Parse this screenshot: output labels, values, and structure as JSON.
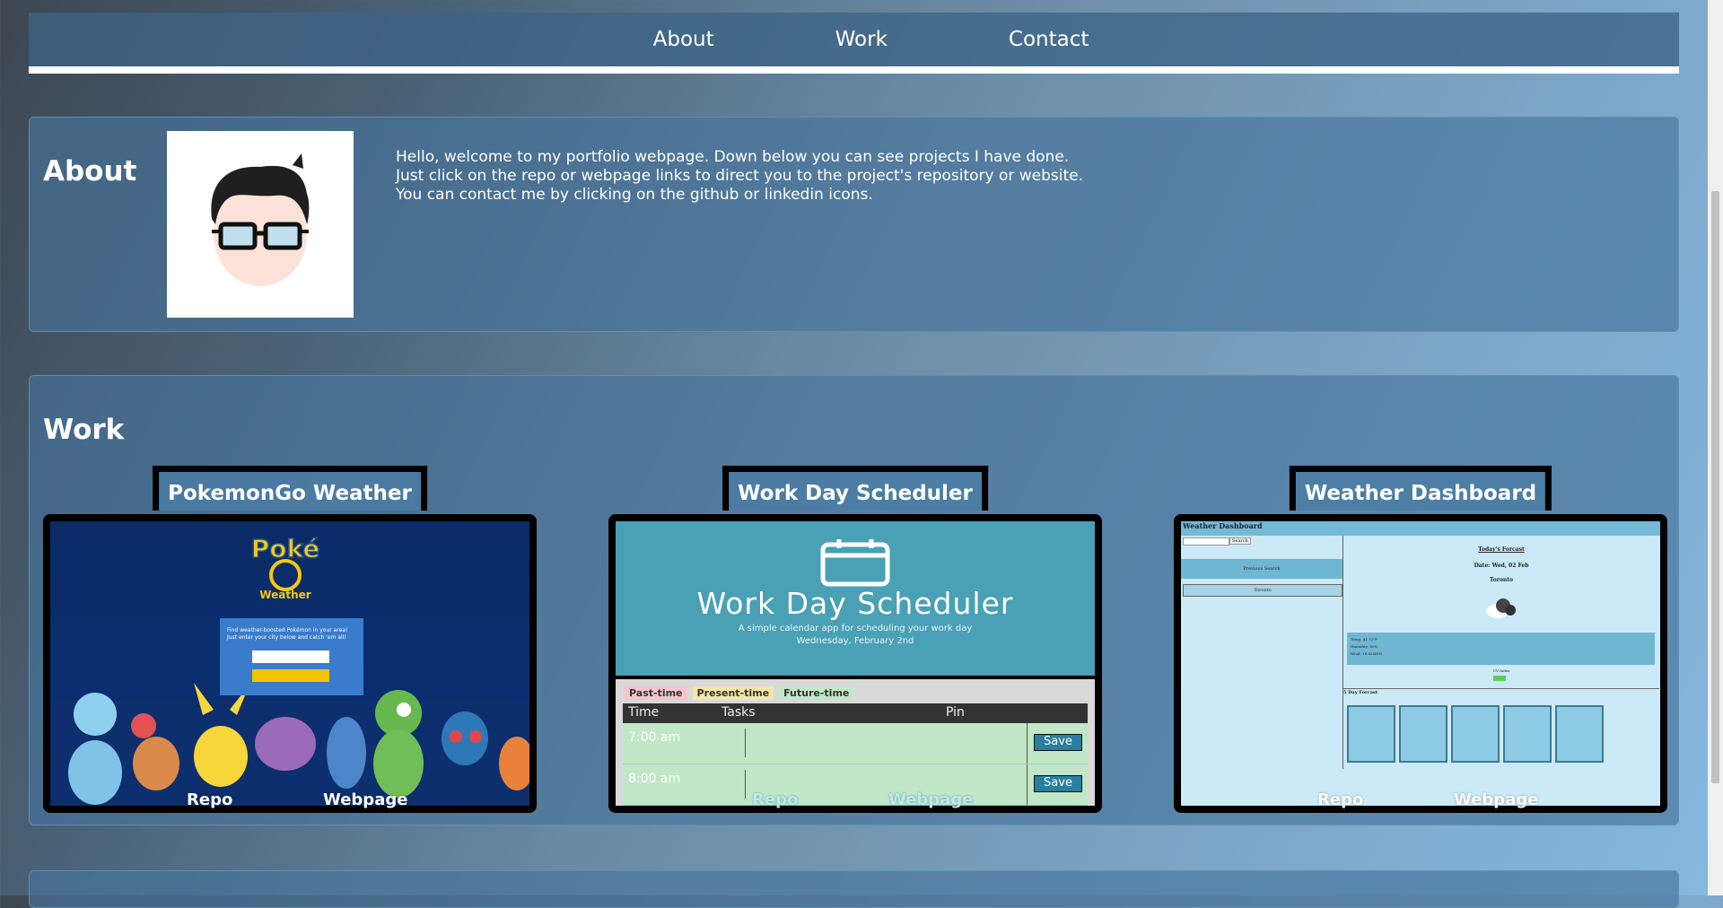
{
  "nav": {
    "links": [
      "About",
      "Work",
      "Contact"
    ]
  },
  "about": {
    "title": "About",
    "lines": [
      "Hello, welcome to my portfolio webpage. Down below you can see projects I have done.",
      "Just click on the repo or webpage links to direct you to the project's repository or website.",
      "You can contact me by clicking on the github or linkedin icons."
    ]
  },
  "work": {
    "title": "Work",
    "projects": [
      {
        "title": "PokemonGo Weather",
        "repo": "Repo",
        "webpage": "Webpage",
        "shot": {
          "logo": "Poké GO Weather Companion",
          "prompt": "Find weather-boosted Pokémon in your area! Just enter your city below and catch 'em all!",
          "placeholder": "Enter a city",
          "button": "SEARCH"
        }
      },
      {
        "title": "Work Day Scheduler",
        "repo": "Repo",
        "webpage": "Webpage",
        "shot": {
          "heading": "Work Day Scheduler",
          "subtitle": "A simple calendar app for scheduling your work day",
          "date": "Wednesday, February 2nd",
          "legend": [
            "Past-time",
            "Present-time",
            "Future-time"
          ],
          "columns": [
            "Time",
            "Tasks",
            "Pin"
          ],
          "rows": [
            {
              "time": "7:00 am",
              "save": "Save"
            },
            {
              "time": "8:00 am",
              "save": "Save"
            }
          ]
        }
      },
      {
        "title": "Weather Dashboard",
        "repo": "Repo",
        "webpage": "Webpage",
        "shot": {
          "header": "Weather Dashboard",
          "search": "Search",
          "previous": "Previous Search",
          "recent": "Toronto",
          "today_title": "Today's Forcast",
          "date": "Date: Wed, 02 Feb",
          "city": "Toronto",
          "stats": [
            "Temp: 41.72°F",
            "Humidity: 60%",
            "Wind: 18.02MPH"
          ],
          "uv": "UV Index",
          "five_day": "5 Day Forcast"
        }
      }
    ]
  },
  "colors": {
    "nav_underline": "#ffffff",
    "section_bg": "#46739b",
    "project_border": "#000000"
  }
}
